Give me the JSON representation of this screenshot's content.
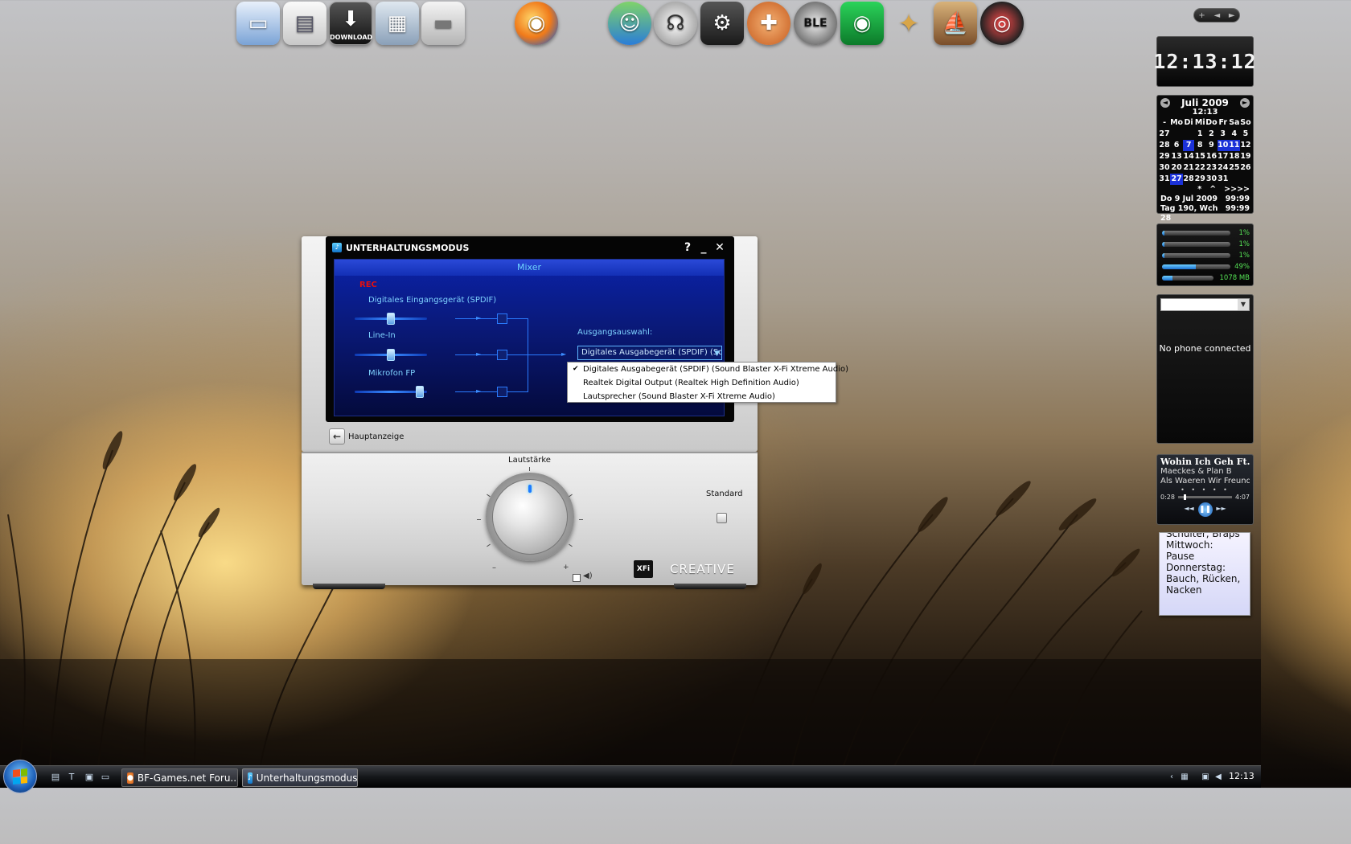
{
  "desktop": {
    "dock": [
      {
        "name": "computer",
        "icon": "computer-icon"
      },
      {
        "name": "documents",
        "icon": "documents-icon"
      },
      {
        "name": "download",
        "icon": "download-icon",
        "label": "DOWNLOAD"
      },
      {
        "name": "pictures",
        "icon": "pictures-icon"
      },
      {
        "name": "drive",
        "icon": "drive-icon"
      },
      {
        "name": "firefox",
        "icon": "firefox-icon"
      },
      {
        "name": "messenger",
        "icon": "messenger-icon"
      },
      {
        "name": "headphones",
        "icon": "headphones-icon"
      },
      {
        "name": "steam",
        "icon": "steam-icon"
      },
      {
        "name": "team-fortress",
        "icon": "tf2-icon"
      },
      {
        "name": "ble",
        "icon": "ble-icon",
        "label": "BLE"
      },
      {
        "name": "eye",
        "icon": "eye-icon"
      },
      {
        "name": "gimp",
        "icon": "gimp-icon"
      },
      {
        "name": "ship-game",
        "icon": "ship-icon"
      },
      {
        "name": "test-drive",
        "icon": "test-drive-icon"
      }
    ]
  },
  "sidebar": {
    "controls": {
      "add": "+",
      "prev": "◄",
      "next": "►"
    },
    "clock": {
      "time": "12:13:12"
    },
    "calendar": {
      "month_title": "Juli 2009",
      "time": "12:13",
      "headers": [
        "-",
        "Mo",
        "Di",
        "Mi",
        "Do",
        "Fr",
        "Sa",
        "So"
      ],
      "rows": [
        [
          "27",
          "",
          "",
          "1",
          "2",
          "3",
          "4",
          "5"
        ],
        [
          "28",
          "6",
          "7",
          "8",
          "9",
          "10",
          "11",
          "12"
        ],
        [
          "29",
          "13",
          "14",
          "15",
          "16",
          "17",
          "18",
          "19"
        ],
        [
          "30",
          "20",
          "21",
          "22",
          "23",
          "24",
          "25",
          "26"
        ],
        [
          "31",
          "27",
          "28",
          "29",
          "30",
          "31",
          "",
          ""
        ]
      ],
      "nav_row": [
        "*",
        "^",
        ">>>>"
      ],
      "footer_left_1": "Do 9 Jul 2009",
      "footer_right_1": "99:99",
      "footer_left_2": "Tag 190, Wch 28",
      "footer_right_2": "99:99"
    },
    "meters": [
      {
        "value": "1%",
        "fill": 0.01
      },
      {
        "value": "1%",
        "fill": 0.01
      },
      {
        "value": "1%",
        "fill": 0.01
      },
      {
        "value": "49%",
        "fill": 0.49
      },
      {
        "value": "1078 MB",
        "fill": 0.2
      }
    ],
    "phone": {
      "status": "No phone connected"
    },
    "music": {
      "title": "Wohin Ich Geh Ft. Celi",
      "artist": "Maeckes & Plan B",
      "album": "Als Waeren Wir Freunde",
      "rating": "• • • • •",
      "elapsed": "0:28",
      "duration": "4:07",
      "progress": 0.11
    },
    "note": {
      "lines": [
        "Schulter, Braps",
        "Mittwoch: Pause",
        "Donnerstag:",
        "Bauch, Rücken,",
        "Nacken"
      ]
    }
  },
  "window": {
    "title": "UNTERHALTUNGSMODUS",
    "help": "?",
    "minimize": "_",
    "close": "✕",
    "mixer_tab": "Mixer",
    "rec_label": "REC",
    "channels": [
      {
        "label": "Digitales Eingangsgerät (SPDIF)",
        "level": 0.5
      },
      {
        "label": "Line-In",
        "level": 0.5
      },
      {
        "label": "Mikrofon FP",
        "level": 0.95
      }
    ],
    "output_label": "Ausgangsauswahl:",
    "output_value": "Digitales Ausgabegerät (SPDIF) (Sou",
    "output_options": [
      {
        "label": "Digitales Ausgabegerät (SPDIF) (Sound Blaster X-Fi Xtreme Audio)",
        "checked": true
      },
      {
        "label": "Realtek Digital Output (Realtek High Definition Audio)",
        "checked": false
      },
      {
        "label": "Lautsprecher (Sound Blaster X-Fi Xtreme Audio)",
        "checked": false
      }
    ],
    "home_label": "Hauptanzeige",
    "volume_label": "Lautstärke",
    "volume_minus": "–",
    "volume_plus": "+",
    "standard_label": "Standard",
    "xfi_logo": "XFi",
    "brand": "CREATIVE"
  },
  "taskbar": {
    "tasks": [
      {
        "label": "BF-Games.net Foru...",
        "icon": "firefox-icon"
      },
      {
        "label": "Unterhaltungsmodus",
        "icon": "creative-icon"
      }
    ],
    "time": "12:13"
  }
}
